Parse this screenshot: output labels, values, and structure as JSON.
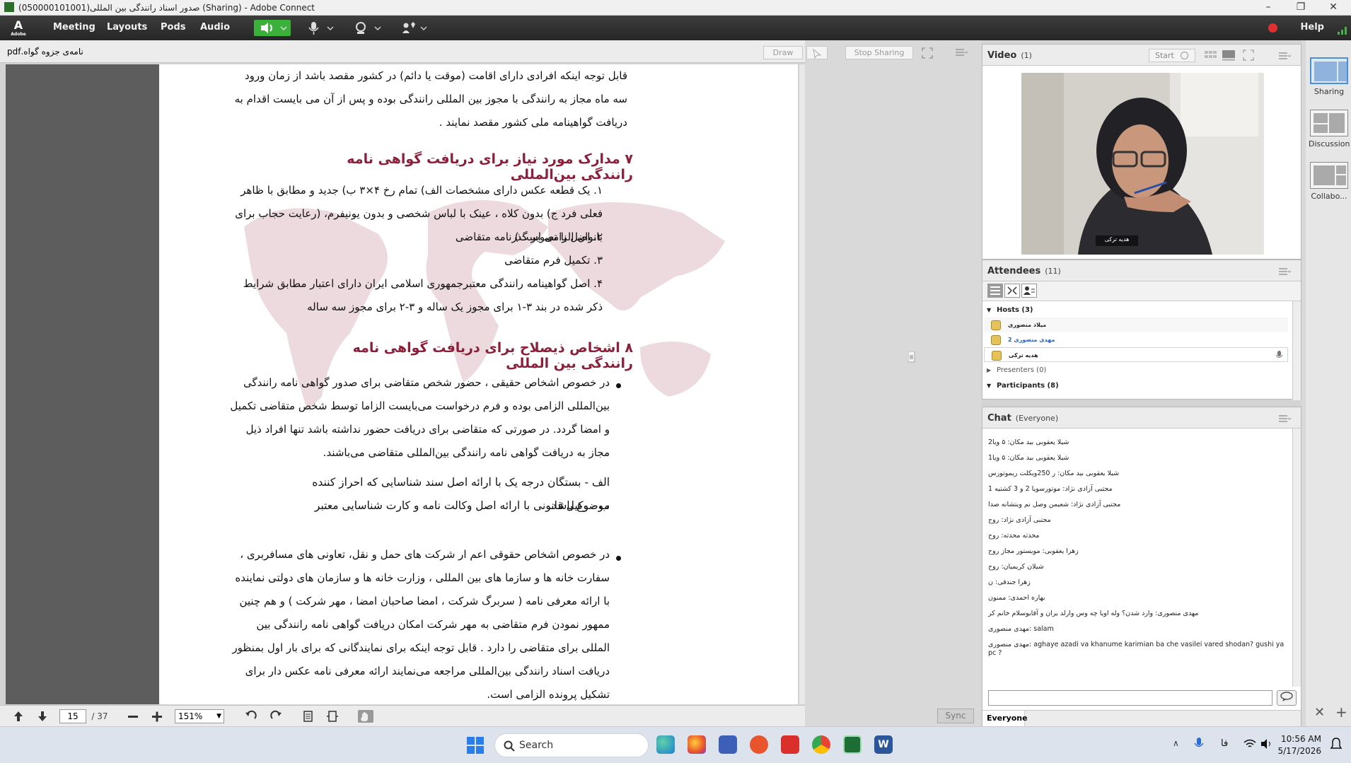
{
  "window": {
    "title": "صدور اسناد رانندگی بین المللی(050000101001) (Sharing) - Adobe Connect"
  },
  "menubar": {
    "logo_text": "Adobe",
    "items": [
      "Meeting",
      "Layouts",
      "Pods",
      "Audio"
    ],
    "help": "Help"
  },
  "share_pod": {
    "filename": "نامه‌ی جزوه گواه.pdf",
    "buttons": {
      "draw": "Draw",
      "stop_sharing": "Stop Sharing"
    },
    "page": {
      "para1": "قابل توجه اینکه افرادی دارای اقامت (موقت یا دائم) در کشور مقصد باشد از زمان ورود سه ماه مجاز به رانندگی با مجوز بین المللی رانندگی بوده و پس از آن می بایست اقدام به دریافت گواهینامه ملی کشور مقصد نمایند .",
      "heading7": "۷  مدارک مورد نیاز برای دریافت گواهی نامه رانندگی بین‌المللی",
      "items7": [
        "۱.  یک قطعه عکس دارای مشخصات الف) تمام رخ ۴×۳ ب) جدید و مطابق با ظاهر فعلی فرد ج) بدون کلاه ، عینک با لباس شخصی و بدون یونیفرم، (رعایت حجاب برای بانوان الزامی است)",
        "۲.  اصل یا تصویر گذرنامه متقاضی",
        "۳.  تکمیل فرم متقاضی",
        "۴.  اصل گواهینامه رانندگی معتبرجمهوری اسلامی ایران دارای اعتبار مطابق شرایط ذکر شده در بند ۳-۱ برای مجوز یک ساله و ۳-۲ برای مجوز سه ساله"
      ],
      "heading8": "۸  اشخاص ذیصلاح برای دریافت گواهی نامه رانندگی بین المللی",
      "bullet1": "در خصوص اشخاص حقیقی ، حضور شخص متقاضی برای صدور گواهی نامه رانندگی بین‌المللی الزامی بوده و فرم درخواست می‌بایست الزاما توسط شخص متقاضی تکمیل و امضا گردد. در صورتی که متقاضی برای دریافت حضور نداشته باشد تنها افراد ذیل مجاز به دریافت گواهی نامه رانندگی بین‌المللی متقاضی می‌باشند.",
      "sub_a": "الف - بستگان درجه یک با ارائه اصل سند شناسایی که احراز کننده موضوع باشد.",
      "sub_b": "ب - وکیل قانونی با ارائه اصل وکالت نامه و کارت شناسایی معتبر",
      "bullet2": "در خصوص اشخاص حقوقی اعم ار شرکت های حمل و نقل، تعاونی های مسافربری ، سفارت خانه ها و سازما های بین المللی ، وزارت خانه ها و سازمان های دولتی نماینده با ارائه معرفی نامه ( سربرگ شرکت ، امضا صاحبان امضا ، مهر شرکت ) و هم چنین ممهور نمودن فرم متقاضی به مهر شرکت امکان دریافت گواهی نامه رانندگی بین المللی برای متقاضی را دارد .  قابل توجه اینکه برای نمایندگانی که برای بار اول بمنظور دریافت اسناد رانندگی بین‌المللی مراجعه می‌نمایند ارائه معرفی نامه عکس دار برای تشکیل پرونده الزامی است."
    },
    "bottom": {
      "page_current": "15",
      "page_total": "/ 37",
      "zoom": "151%",
      "sync": "Sync"
    }
  },
  "video_pod": {
    "title": "Video",
    "count": "(1)",
    "start": "Start",
    "name_tag": "هدیه ترکی"
  },
  "attendees_pod": {
    "title": "Attendees",
    "count": "(11)",
    "hosts_label": "Hosts (3)",
    "hosts": [
      "میلاد منصوری",
      "مهدی منصوری 2",
      "هدیه ترکی"
    ],
    "presenters_label": "Presenters (0)",
    "participants_label": "Participants (8)"
  },
  "chat_pod": {
    "title": "Chat",
    "scope": "(Everyone)",
    "messages": [
      "شیلا یعقوبی بید مکان: ۵ ویا2",
      "شیلا یعقوبی بید مکان: ۵ ویا1",
      "شیلا یعقوبی بید مکان: ر 250ویکلت ریموتورس",
      "مجتبی آزادی نژاد: موتورسویا 2 و 3 کشتیه 1",
      "مجتبی آزادی نژاد: شعیمن وصل نم ویتشانه صدا",
      "مجتبی آزادی نژاد: روح",
      "محدثه محدثه: روح",
      "زهرا یعقوبی: مویستور مجاز روح",
      "شیلان کریمیان: روح",
      "زهرا جندقی: ن",
      "بهاره احمدی: ممنون",
      "مهدی منصوری: وارد شدن؟ وله اویا چه وس وارلد یران و آقایوسلام خانم کر",
      "مهدی منصوری: salam",
      "مهدی منصوری: aghaye azadi va khanume karimian ba che vasilei vared shodan? gushi ya pc ?"
    ],
    "audience": "Everyone"
  },
  "side_strip": {
    "items": [
      "Sharing",
      "Discussion",
      "Collabo..."
    ]
  },
  "taskbar": {
    "search_placeholder": "Search",
    "time": "10:56 AM",
    "date": "5/17/2026",
    "lang": "فا"
  },
  "colors": {
    "heading": "#8c1f39",
    "menubar": "#2f2f2f",
    "accent_green": "#3bb03b"
  }
}
